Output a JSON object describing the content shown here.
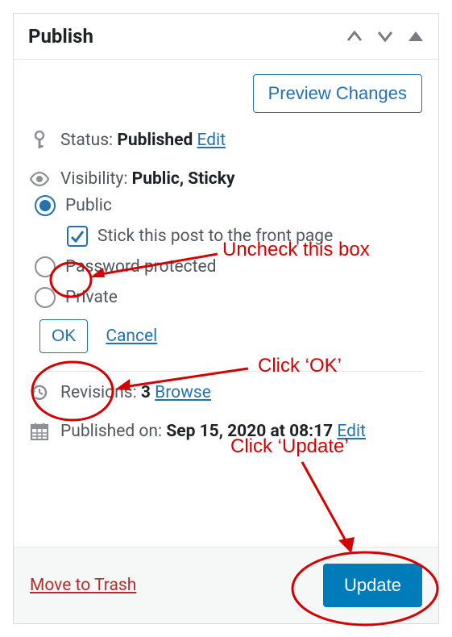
{
  "header": {
    "title": "Publish"
  },
  "preview": {
    "label": "Preview Changes"
  },
  "status": {
    "label": "Status:",
    "value": "Published",
    "edit_label": "Edit"
  },
  "visibility": {
    "label": "Visibility:",
    "value": "Public, Sticky",
    "options": {
      "public": "Public",
      "sticky_label": "Stick this post to the front page",
      "password": "Password protected",
      "private": "Private"
    },
    "ok_label": "OK",
    "cancel_label": "Cancel"
  },
  "revisions": {
    "label": "Revisions:",
    "count": "3",
    "browse_label": "Browse"
  },
  "published_on": {
    "label": "Published on:",
    "value": "Sep 15, 2020 at 08:17",
    "edit_label": "Edit"
  },
  "footer": {
    "trash_label": "Move to Trash",
    "update_label": "Update"
  },
  "annotations": {
    "uncheck": "Uncheck this box",
    "click_ok": "Click ‘OK’",
    "click_update": "Click ‘Update’"
  }
}
